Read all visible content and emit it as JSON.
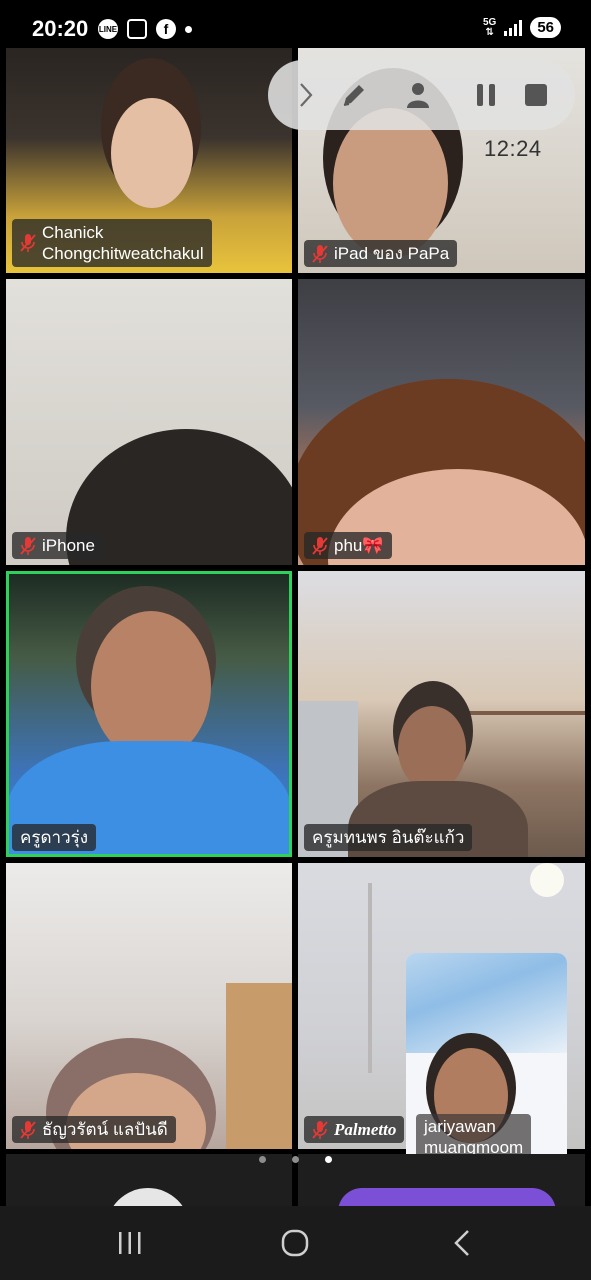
{
  "status_bar": {
    "time": "20:20",
    "app_icons": [
      "line-icon",
      "screenshot-icon",
      "facebook-icon"
    ],
    "network": "5G",
    "battery": "56"
  },
  "controls": {
    "recording_time": "12:24",
    "buttons": [
      "expand-icon",
      "pen-icon",
      "person-icon",
      "pause-icon",
      "stop-icon"
    ]
  },
  "participants": [
    {
      "name": "Chanick\nChongchitweatchakul",
      "muted": true
    },
    {
      "name": "iPad ของ PaPa",
      "muted": true
    },
    {
      "name": "iPhone",
      "muted": true
    },
    {
      "name": "phu🎀",
      "muted": true
    },
    {
      "name": "ครูดาวรุ่ง",
      "muted": false,
      "speaking": true
    },
    {
      "name": "ครูมทนพร อินต๊ะแก้ว",
      "muted": false
    },
    {
      "name": "ธัญวรัตน์ แลปันดี",
      "muted": true
    },
    {
      "name": "Palmetto",
      "muted": true
    }
  ],
  "self_view": {
    "name": "jariyawan\nmuangmoom"
  },
  "pager": {
    "pages": 3,
    "current": 3
  },
  "colors": {
    "speaking_border": "#2ed25a",
    "muted_mic": "#e53935",
    "toolbar_accent": "#7b4fd6"
  }
}
